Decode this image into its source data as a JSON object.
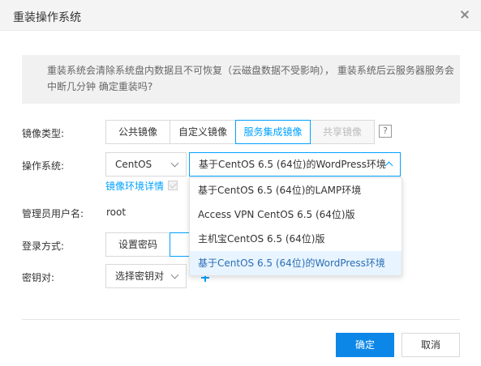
{
  "dialog": {
    "title": "重装操作系统",
    "notice": "重装系统会清除系统盘内数据且不可恢复（云磁盘数据不受影响）， 重装系统后云服务器服务会中断几分钟 确定重装吗?"
  },
  "image_type": {
    "label": "镜像类型:",
    "options": [
      "公共镜像",
      "自定义镜像",
      "服务集成镜像",
      "共享镜像"
    ],
    "selected": "服务集成镜像",
    "help": "?"
  },
  "os": {
    "label": "操作系统:",
    "distro": "CentOS",
    "image": "基于CentOS 6.5 (64位)的WordPress环境",
    "detail_link": "镜像环境详情",
    "dropdown_items": [
      "基于CentOS 6.5 (64位)的LAMP环境",
      "Access VPN CentOS 6.5 (64位)版",
      "主机宝CentOS 6.5 (64位)版",
      "基于CentOS 6.5 (64位)的WordPress环境"
    ]
  },
  "admin": {
    "label": "管理员用户名:",
    "value": "root"
  },
  "login": {
    "label": "登录方式:",
    "options": [
      "设置密码"
    ]
  },
  "keypair": {
    "label": "密钥对:",
    "select": "选择密钥对"
  },
  "footer": {
    "confirm": "确定",
    "cancel": "取消"
  },
  "colors": {
    "accent": "#00a2ff",
    "primary_button": "#0c87e8",
    "dropdown_selected_bg": "#e8f4ff"
  }
}
